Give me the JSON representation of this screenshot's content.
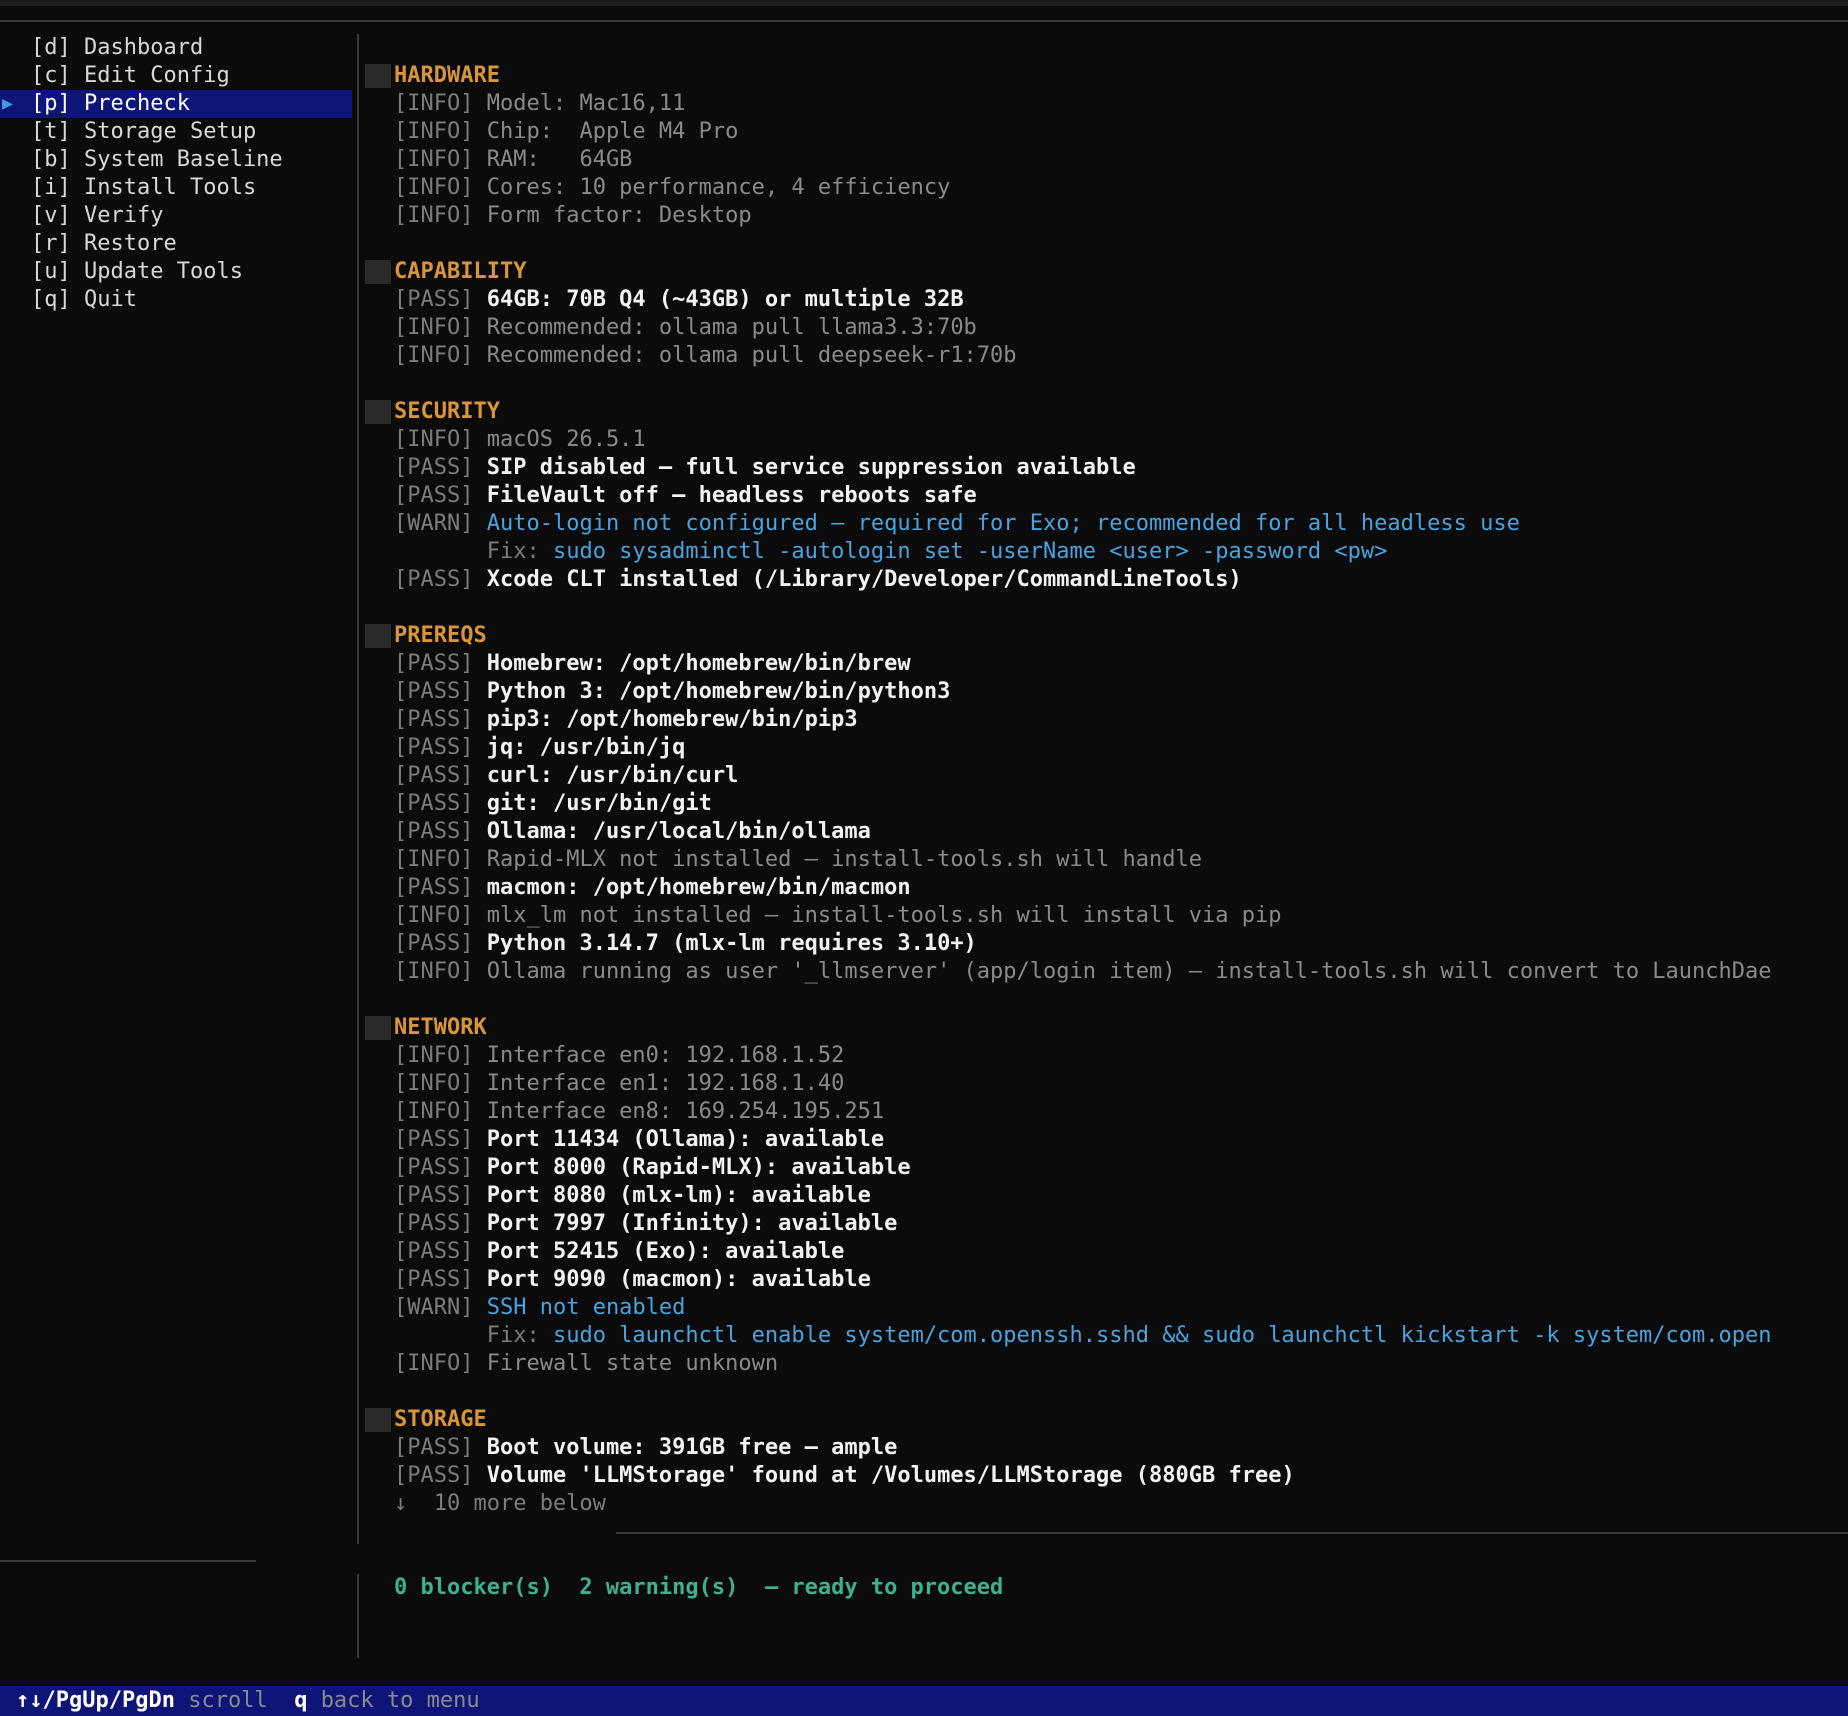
{
  "sidebar": {
    "items": [
      {
        "key": "[d]",
        "label": "Dashboard",
        "selected": false
      },
      {
        "key": "[c]",
        "label": "Edit Config",
        "selected": false
      },
      {
        "key": "[p]",
        "label": "Precheck",
        "selected": true
      },
      {
        "key": "[t]",
        "label": "Storage Setup",
        "selected": false
      },
      {
        "key": "[b]",
        "label": "System Baseline",
        "selected": false
      },
      {
        "key": "[i]",
        "label": "Install Tools",
        "selected": false
      },
      {
        "key": "[v]",
        "label": "Verify",
        "selected": false
      },
      {
        "key": "[r]",
        "label": "Restore",
        "selected": false
      },
      {
        "key": "[u]",
        "label": "Update Tools",
        "selected": false
      },
      {
        "key": "[q]",
        "label": "Quit",
        "selected": false
      }
    ],
    "selected_marker": "▶"
  },
  "sections": [
    {
      "title": "HARDWARE",
      "lines": [
        {
          "tag": "[INFO]",
          "status": "info",
          "text": "Model: Mac16,11"
        },
        {
          "tag": "[INFO]",
          "status": "info",
          "text": "Chip:  Apple M4 Pro"
        },
        {
          "tag": "[INFO]",
          "status": "info",
          "text": "RAM:   64GB"
        },
        {
          "tag": "[INFO]",
          "status": "info",
          "text": "Cores: 10 performance, 4 efficiency"
        },
        {
          "tag": "[INFO]",
          "status": "info",
          "text": "Form factor: Desktop"
        }
      ]
    },
    {
      "title": "CAPABILITY",
      "lines": [
        {
          "tag": "[PASS]",
          "status": "pass",
          "text": "64GB: 70B Q4 (~43GB) or multiple 32B"
        },
        {
          "tag": "[INFO]",
          "status": "info",
          "text": "Recommended: ollama pull llama3.3:70b"
        },
        {
          "tag": "[INFO]",
          "status": "info",
          "text": "Recommended: ollama pull deepseek-r1:70b"
        }
      ]
    },
    {
      "title": "SECURITY",
      "lines": [
        {
          "tag": "[INFO]",
          "status": "info",
          "text": "macOS 26.5.1"
        },
        {
          "tag": "[PASS]",
          "status": "pass",
          "text": "SIP disabled — full service suppression available"
        },
        {
          "tag": "[PASS]",
          "status": "pass",
          "text": "FileVault off — headless reboots safe"
        },
        {
          "tag": "[WARN]",
          "status": "warn",
          "text": "Auto-login not configured — required for Exo; recommended for all headless use"
        },
        {
          "tag": "",
          "status": "fix",
          "label": "Fix:",
          "text": "sudo sysadminctl -autologin set -userName <user> -password <pw>"
        },
        {
          "tag": "[PASS]",
          "status": "pass",
          "text": "Xcode CLT installed (/Library/Developer/CommandLineTools)"
        }
      ]
    },
    {
      "title": "PREREQS",
      "lines": [
        {
          "tag": "[PASS]",
          "status": "pass",
          "text": "Homebrew: /opt/homebrew/bin/brew"
        },
        {
          "tag": "[PASS]",
          "status": "pass",
          "text": "Python 3: /opt/homebrew/bin/python3"
        },
        {
          "tag": "[PASS]",
          "status": "pass",
          "text": "pip3: /opt/homebrew/bin/pip3"
        },
        {
          "tag": "[PASS]",
          "status": "pass",
          "text": "jq: /usr/bin/jq"
        },
        {
          "tag": "[PASS]",
          "status": "pass",
          "text": "curl: /usr/bin/curl"
        },
        {
          "tag": "[PASS]",
          "status": "pass",
          "text": "git: /usr/bin/git"
        },
        {
          "tag": "[PASS]",
          "status": "pass",
          "text": "Ollama: /usr/local/bin/ollama"
        },
        {
          "tag": "[INFO]",
          "status": "info",
          "text": "Rapid-MLX not installed — install-tools.sh will handle"
        },
        {
          "tag": "[PASS]",
          "status": "pass",
          "text": "macmon: /opt/homebrew/bin/macmon"
        },
        {
          "tag": "[INFO]",
          "status": "info",
          "text": "mlx_lm not installed — install-tools.sh will install via pip"
        },
        {
          "tag": "[PASS]",
          "status": "pass",
          "text": "Python 3.14.7 (mlx-lm requires 3.10+)"
        },
        {
          "tag": "[INFO]",
          "status": "info",
          "text": "Ollama running as user '_llmserver' (app/login item) — install-tools.sh will convert to LaunchDae"
        }
      ]
    },
    {
      "title": "NETWORK",
      "lines": [
        {
          "tag": "[INFO]",
          "status": "info",
          "text": "Interface en0: 192.168.1.52"
        },
        {
          "tag": "[INFO]",
          "status": "info",
          "text": "Interface en1: 192.168.1.40"
        },
        {
          "tag": "[INFO]",
          "status": "info",
          "text": "Interface en8: 169.254.195.251"
        },
        {
          "tag": "[PASS]",
          "status": "pass",
          "text": "Port 11434 (Ollama): available"
        },
        {
          "tag": "[PASS]",
          "status": "pass",
          "text": "Port 8000 (Rapid-MLX): available"
        },
        {
          "tag": "[PASS]",
          "status": "pass",
          "text": "Port 8080 (mlx-lm): available"
        },
        {
          "tag": "[PASS]",
          "status": "pass",
          "text": "Port 7997 (Infinity): available"
        },
        {
          "tag": "[PASS]",
          "status": "pass",
          "text": "Port 52415 (Exo): available"
        },
        {
          "tag": "[PASS]",
          "status": "pass",
          "text": "Port 9090 (macmon): available"
        },
        {
          "tag": "[WARN]",
          "status": "warn",
          "text": "SSH not enabled"
        },
        {
          "tag": "",
          "status": "fix",
          "label": "Fix:",
          "text": "sudo launchctl enable system/com.openssh.sshd && sudo launchctl kickstart -k system/com.open"
        },
        {
          "tag": "[INFO]",
          "status": "info",
          "text": "Firewall state unknown"
        }
      ]
    },
    {
      "title": "STORAGE",
      "lines": [
        {
          "tag": "[PASS]",
          "status": "pass",
          "text": "Boot volume: 391GB free — ample"
        },
        {
          "tag": "[PASS]",
          "status": "pass",
          "text": "Volume 'LLMStorage' found at /Volumes/LLMStorage (880GB free)"
        }
      ]
    }
  ],
  "more_below": "↓  10 more below",
  "summary": "0 blocker(s)  2 warning(s)  — ready to proceed",
  "statusbar": {
    "scroll_keys": "↑↓/PgUp/PgDn",
    "scroll_label": "scroll",
    "back_key": "q",
    "back_label": "back to menu"
  },
  "colors": {
    "background": "#0b0b0b",
    "selection": "#0e1478",
    "section_header": "#d9953a",
    "warn_text": "#4aa3df",
    "summary": "#3fb092"
  }
}
